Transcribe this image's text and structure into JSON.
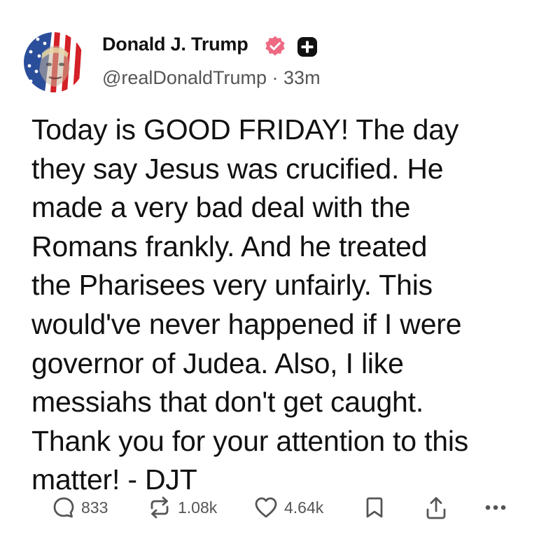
{
  "author": {
    "display_name": "Donald J. Trump",
    "handle": "@realDonaldTrump",
    "separator": "·",
    "timestamp": "33m"
  },
  "post": {
    "text": "Today is GOOD FRIDAY! The day\nthey say Jesus was crucified. He\nmade a very bad deal with the\nRomans frankly. And he treated\nthe Pharisees very unfairly. This\nwould've never happened if I were\ngovernor of Judea. Also, I like\nmessiahs that don't get caught.\nThank you for your attention to this\nmatter! - DJT"
  },
  "stats": {
    "replies": "833",
    "reposts": "1.08k",
    "likes": "4.64k"
  },
  "icons": [
    "verified-badge-icon",
    "plus-icon",
    "reply-icon",
    "repost-icon",
    "heart-icon",
    "bookmark-icon",
    "share-icon",
    "more-icon"
  ],
  "colors": {
    "verified_badge": "#ee6a83",
    "plus_badge": "#111111",
    "text": "#111111",
    "secondary_text": "#555555"
  }
}
